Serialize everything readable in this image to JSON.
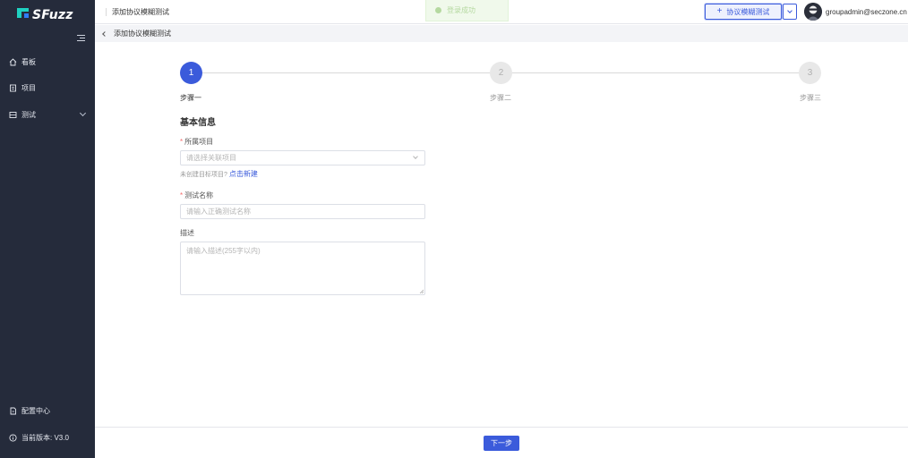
{
  "brand": {
    "name": "SFuzz"
  },
  "sidebar": {
    "items": [
      {
        "label": "看板",
        "icon": "home-icon"
      },
      {
        "label": "项目",
        "icon": "document-icon"
      },
      {
        "label": "测试",
        "icon": "list-icon"
      }
    ],
    "bottom": [
      {
        "label": "配置中心",
        "icon": "config-icon"
      },
      {
        "label": "当前版本: V3.0",
        "icon": "info-icon"
      }
    ]
  },
  "header": {
    "title": "添加协议模糊测试",
    "toast": "登录成功",
    "add_button": "协议模糊测试",
    "user": "groupadmin@seczone.cn"
  },
  "subbar": {
    "title": "添加协议模糊测试"
  },
  "steps": [
    {
      "number": "1",
      "label": "步骤一",
      "active": true
    },
    {
      "number": "2",
      "label": "步骤二",
      "active": false
    },
    {
      "number": "3",
      "label": "步骤三",
      "active": false
    }
  ],
  "form": {
    "section_title": "基本信息",
    "project": {
      "required_mark": "*",
      "label": "所属项目",
      "placeholder": "请选择关联项目"
    },
    "hint": {
      "text": "未创建目标项目?",
      "link": "点击新建"
    },
    "name": {
      "required_mark": "*",
      "label": "测试名称",
      "placeholder": "请输入正确测试名称"
    },
    "description": {
      "label": "描述",
      "placeholder": "请输入描述(255字以内)"
    }
  },
  "footer": {
    "next_button": "下一步"
  },
  "colors": {
    "primary": "#3b5bdb",
    "sidebar_bg": "#252b3b",
    "success": "#b5d9a0",
    "required": "#f56c6c"
  }
}
